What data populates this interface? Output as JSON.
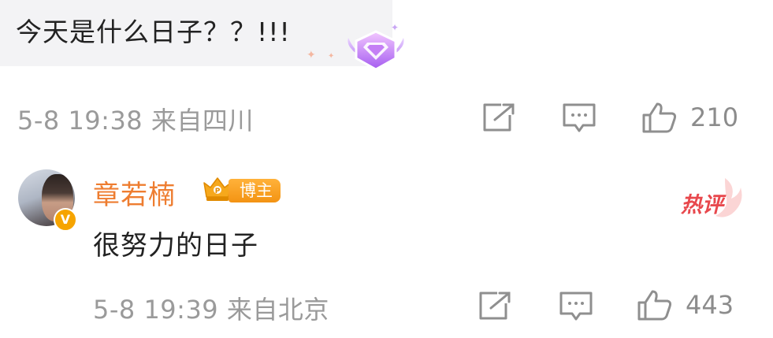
{
  "top_comment": {
    "text": "今天是什么日子？？!!!",
    "badge_icon": "purple-gem-badge-icon",
    "meta": "5-8 19:38 来自四川",
    "likes": "210"
  },
  "reply": {
    "username": "章若楠",
    "blogger_badge": "博主",
    "verified_mark": "V",
    "text": "很努力的日子",
    "hot_badge": "热评",
    "meta": "5-8 19:39 来自北京",
    "likes": "443"
  },
  "colors": {
    "username": "#ee7d30",
    "meta": "#9a9a9a",
    "hot": "#e8484d",
    "bubble_bg": "#f3f3f5"
  }
}
